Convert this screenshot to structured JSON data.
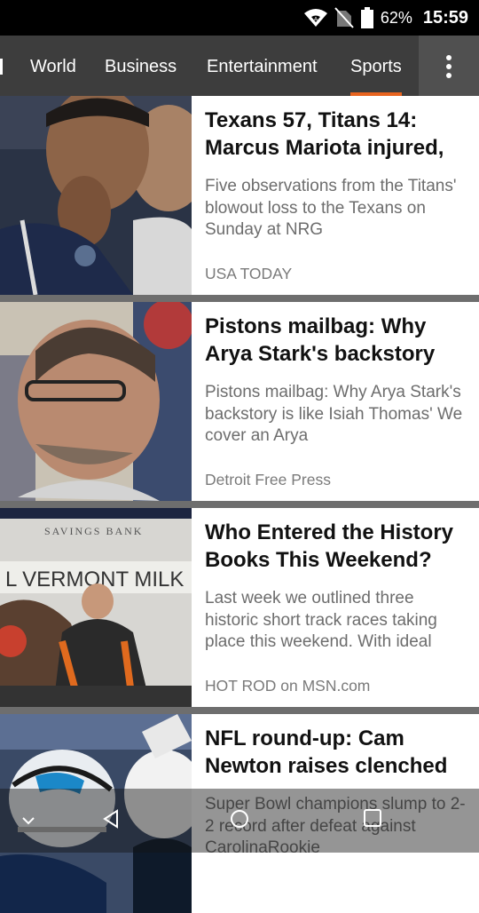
{
  "status_bar": {
    "battery": "62%",
    "time": "15:59",
    "icons": [
      "wifi-icon",
      "no-sim-icon",
      "battery-icon"
    ]
  },
  "tabs": [
    {
      "label": "World"
    },
    {
      "label": "Business"
    },
    {
      "label": "Entertainment"
    },
    {
      "label": "Sports",
      "active": true
    }
  ],
  "accent_color": "#e8641f",
  "articles": [
    {
      "headline": "Texans 57, Titans 14: Marcus Mariota injured,",
      "snippet": "Five observations from the Titans' blowout loss to the Texans on Sunday at NRG",
      "source": "USA TODAY"
    },
    {
      "headline": "Pistons mailbag: Why Arya Stark's backstory",
      "snippet": "Pistons mailbag: Why Arya Stark's backstory is like Isiah Thomas' We cover an Arya",
      "source": "Detroit Free Press"
    },
    {
      "headline": "Who Entered the History Books This Weekend?",
      "snippet": "Last week we outlined three historic short track races taking place this weekend. With ideal",
      "source": "HOT ROD on MSN.com",
      "image_text": {
        "top": "SAVINGS BANK",
        "banner": "L VERMONT MILK"
      }
    },
    {
      "headline": "NFL round-up: Cam Newton raises clenched",
      "snippet": "Super Bowl champions slump to 2-2 record after defeat against CarolinaRookie",
      "source": ""
    }
  ],
  "nav_bar": {
    "icons": [
      "chevron-down-icon",
      "back-icon",
      "home-icon",
      "recents-icon"
    ]
  }
}
